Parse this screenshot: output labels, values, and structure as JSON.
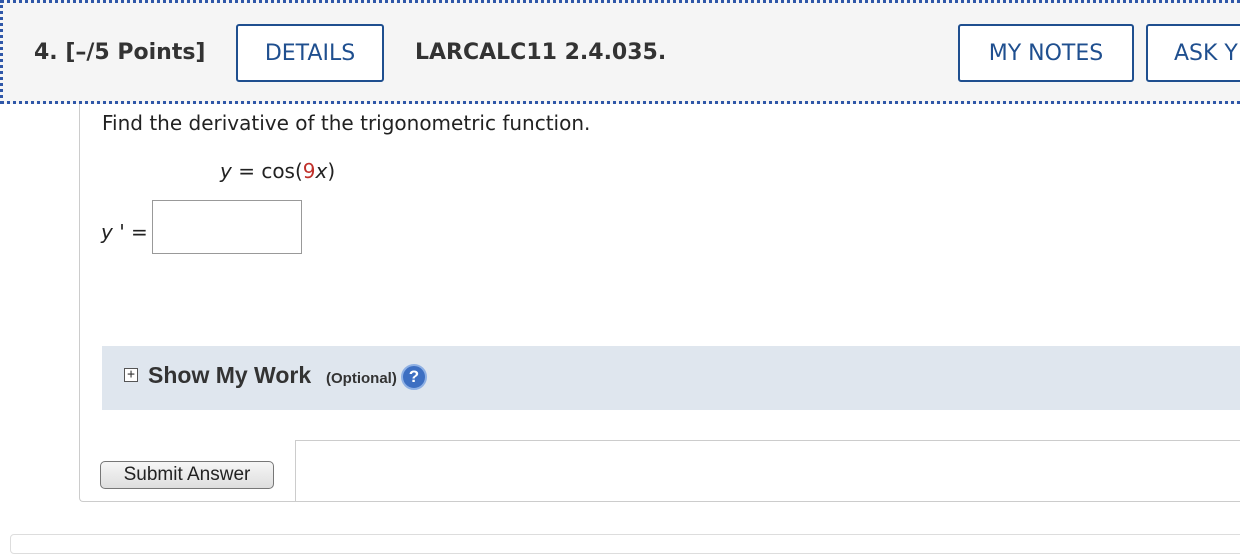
{
  "header": {
    "question_label": "4. [–/5 Points]",
    "details_label": "DETAILS",
    "question_code": "LARCALC11 2.4.035.",
    "my_notes_label": "MY NOTES",
    "ask_label": "ASK Y"
  },
  "question": {
    "prompt": "Find the derivative of the trigonometric function.",
    "equation_lhs": "y",
    "equation_eq": " = cos(",
    "equation_coef": "9",
    "equation_var": "x",
    "equation_close": ")",
    "answer_label_var": "y",
    "answer_label_rest": " ' =",
    "answer_value": ""
  },
  "show_work": {
    "toggle_icon": "plus-square-icon",
    "title": "Show My Work",
    "optional_label": "(Optional)",
    "help_icon": "help-icon",
    "help_glyph": "?"
  },
  "actions": {
    "submit_label": "Submit Answer"
  },
  "colors": {
    "accent": "#1f4f8f",
    "highlight_number": "#c0302a",
    "work_bar_bg": "#dfe6ee",
    "header_border": "#2f57a8"
  }
}
